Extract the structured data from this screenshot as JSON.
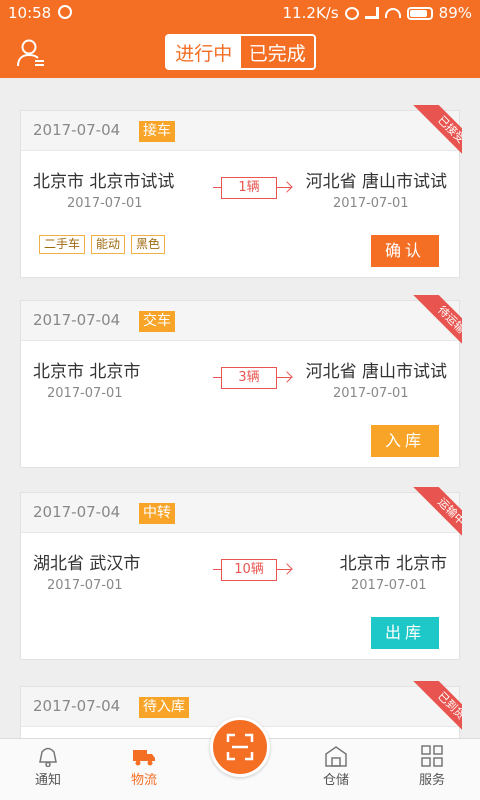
{
  "status_bar": {
    "time": "10:58",
    "network_speed": "11.2K/s",
    "battery": "89%",
    "battery_level": 0.89
  },
  "header": {
    "tabs": [
      {
        "label": "进行中",
        "active": true
      },
      {
        "label": "已完成",
        "active": false
      }
    ]
  },
  "orders": [
    {
      "date": "2017-07-04",
      "tag": "接车",
      "status": "已接受",
      "from_city": "北京市 北京市试试",
      "from_date": "2017-07-01",
      "count": "1辆",
      "to_city": "河北省 唐山市试试",
      "to_date": "2017-07-01",
      "props": [
        "二手车",
        "能动",
        "黑色"
      ],
      "action": "确认",
      "action_color": "#f46e24"
    },
    {
      "date": "2017-07-04",
      "tag": "交车",
      "status": "待运输",
      "from_city": "北京市 北京市",
      "from_date": "2017-07-01",
      "count": "3辆",
      "to_city": "河北省 唐山市试试",
      "to_date": "2017-07-01",
      "props": [],
      "action": "入库",
      "action_color": "#f7a428"
    },
    {
      "date": "2017-07-04",
      "tag": "中转",
      "status": "运输中",
      "from_city": "湖北省 武汉市",
      "from_date": "2017-07-01",
      "count": "10辆",
      "to_city": "北京市 北京市",
      "to_date": "2017-07-01",
      "props": [],
      "action": "出库",
      "action_color": "#1ec8c8"
    },
    {
      "date": "2017-07-04",
      "tag": "待入库",
      "status": "已到货"
    }
  ],
  "bottom_nav": [
    {
      "label": "通知",
      "icon": "bell-icon",
      "active": false
    },
    {
      "label": "物流",
      "icon": "truck-icon",
      "active": true
    },
    {
      "label": "",
      "icon": "scan-icon",
      "active": false
    },
    {
      "label": "仓储",
      "icon": "warehouse-icon",
      "active": false
    },
    {
      "label": "服务",
      "icon": "grid-icon",
      "active": false
    }
  ]
}
